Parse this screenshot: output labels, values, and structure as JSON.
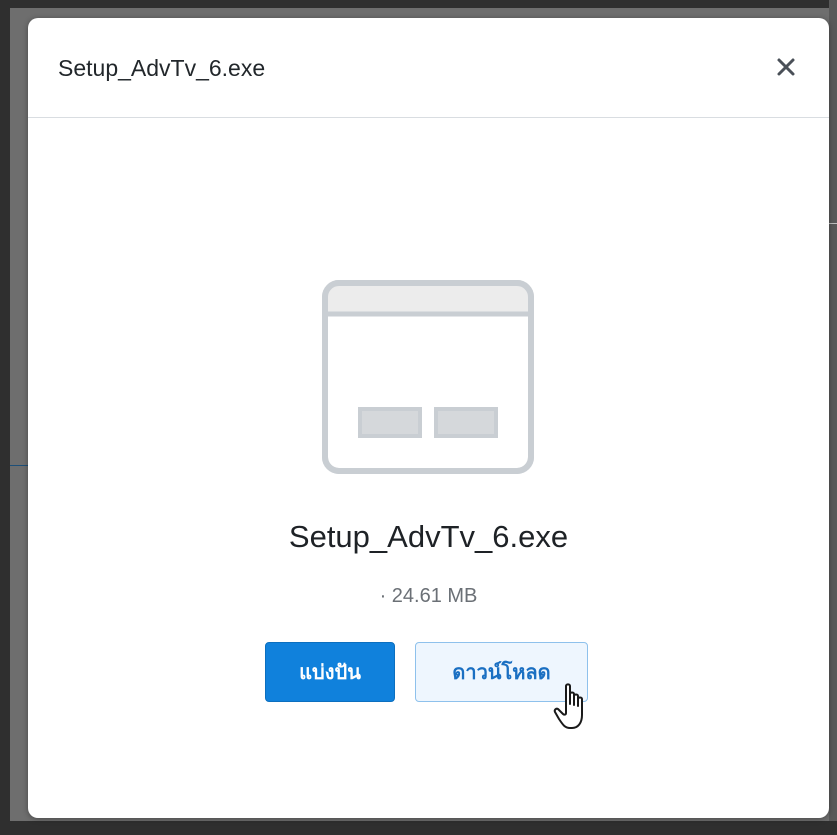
{
  "dialog": {
    "title": "Setup_AdvTv_6.exe",
    "close_icon": "close-icon"
  },
  "file": {
    "icon": "window-icon",
    "name": "Setup_AdvTv_6.exe",
    "meta": "· 24.61 MB"
  },
  "actions": {
    "share_label": "แบ่งปัน",
    "download_label": "ดาวน์โหลด"
  },
  "colors": {
    "primary": "#1081dc",
    "secondary_bg": "#eef6fe",
    "secondary_text": "#1a6fc2",
    "icon_stroke": "#c9ced3"
  },
  "pointer": "hand-pointer-icon"
}
